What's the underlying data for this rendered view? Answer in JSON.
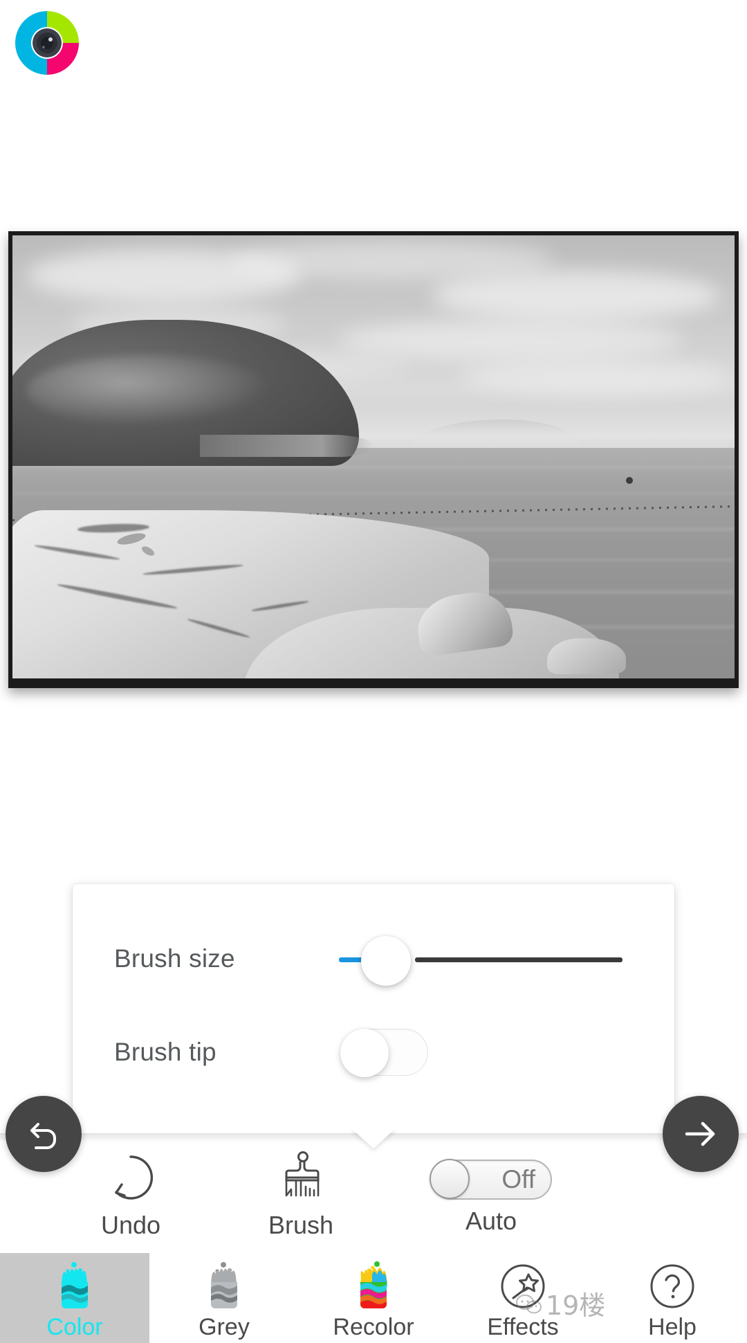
{
  "app": {
    "logo_icon": "camera-lens-logo-icon",
    "logo_colors": {
      "cyan": "#00b5e2",
      "green": "#a4e600",
      "pink": "#f5056e",
      "lens": "#333740"
    }
  },
  "photo": {
    "name": "seascape-photo",
    "description": "Black and white photo of a rocky coastline with a headland, sea and distant island",
    "brush_stroke_color": "#2fb9d6"
  },
  "settings_popover": {
    "rows": [
      {
        "label": "Brush size",
        "control": "slider",
        "slider": {
          "fill_color": "#1a94e0",
          "track_color": "#3a3a3a",
          "value_percent": 16
        }
      },
      {
        "label": "Brush tip",
        "control": "toggle",
        "toggle": {
          "state": "off"
        }
      }
    ]
  },
  "fabs": {
    "back": {
      "label": "back",
      "icon": "undo-arrow-icon"
    },
    "next": {
      "label": "next",
      "icon": "arrow-right-icon"
    }
  },
  "tools": [
    {
      "label": "Undo",
      "icon": "undo-circle-icon"
    },
    {
      "label": "Brush",
      "icon": "paint-brush-icon"
    },
    {
      "label": "Auto",
      "icon": "auto-toggle-icon",
      "toggle_value": "Off",
      "toggle_state": "off"
    }
  ],
  "bottom_nav": {
    "active_index": 0,
    "active_color": "#14e6ef",
    "items": [
      {
        "label": "Color",
        "icon": "paint-splash-cyan-icon",
        "active": true
      },
      {
        "label": "Grey",
        "icon": "paint-splash-grey-icon",
        "active": false
      },
      {
        "label": "Recolor",
        "icon": "paint-splash-multi-icon",
        "active": false
      },
      {
        "label": "Effects",
        "icon": "magic-wand-circle-icon",
        "active": false
      },
      {
        "label": "Help",
        "icon": "question-mark-circle-icon",
        "active": false
      }
    ]
  },
  "watermark": {
    "text": "19楼"
  }
}
